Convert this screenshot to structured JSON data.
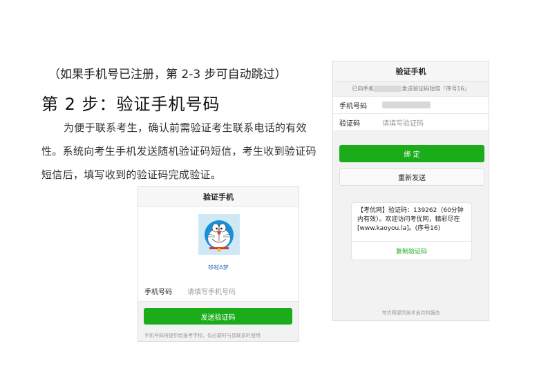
{
  "doc": {
    "note": "（如果手机号已注册，第 2-3 步可自动跳过）",
    "step_title": "第 2 步：验证手机号码",
    "paragraph": "为便于联系考生，确认前需验证考生联系电话的有效性。系统向考生手机发送随机验证码短信，考生收到验证码短信后，填写收到的验证码完成验证。"
  },
  "phone_left": {
    "title": "验证手机",
    "avatar_name": "哆啦A梦",
    "phone_label": "手机号码",
    "phone_placeholder": "请填写手机号码",
    "send_button": "发送验证码",
    "footnote": "手机号码将提供给报考学校，仅必要时与您联系时使用"
  },
  "phone_right": {
    "title": "验证手机",
    "subbar_prefix": "已向手机",
    "subbar_suffix": "发送验证码短信「序号16」",
    "phone_label": "手机号码",
    "code_label": "验证码",
    "code_placeholder": "请填写验证码",
    "bind_button": "绑 定",
    "resend_button": "重新发送",
    "sms_text": "【考优网】验证码：139262（60分钟内有效）。欢迎访问考优网，精彩尽在[www.kaoyou.la]。(序号16)",
    "copy_link": "复制验证码",
    "footer": "考优网提供技术支持和服务"
  },
  "colors": {
    "accent_green": "#1aad19",
    "link_blue": "#3a6fbf"
  },
  "icons": {
    "avatar": "doraemon-avatar"
  }
}
